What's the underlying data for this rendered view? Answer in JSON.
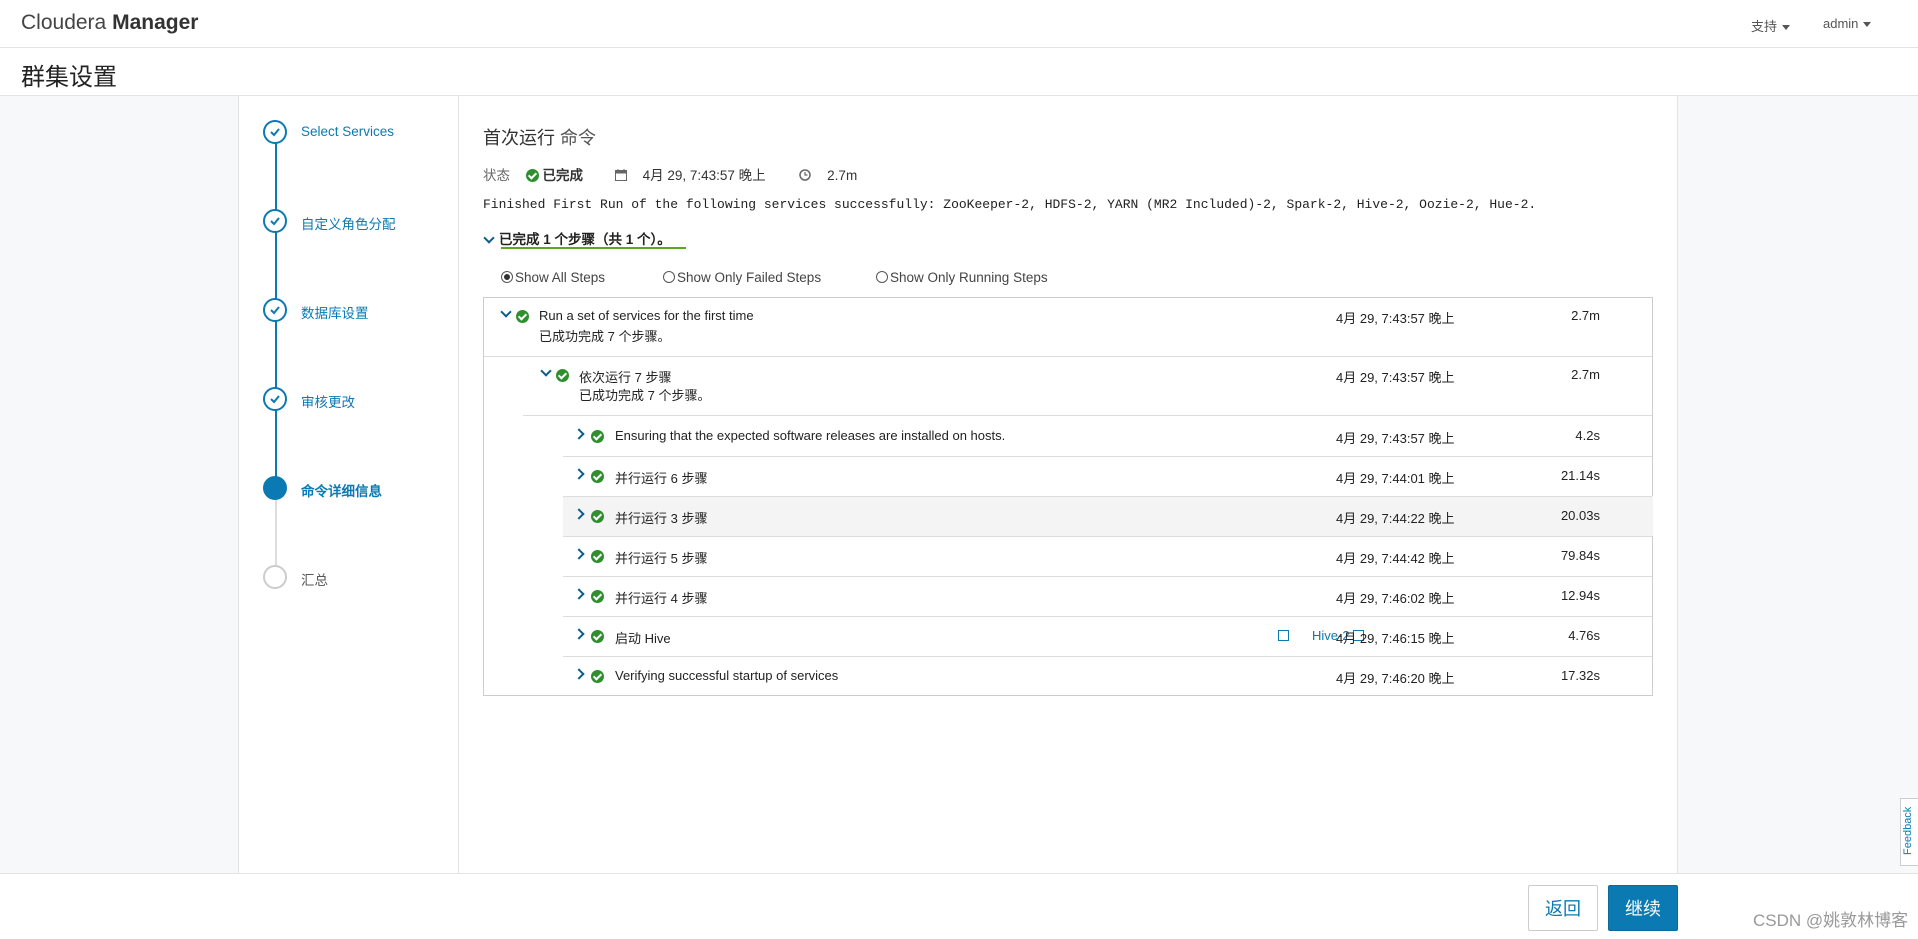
{
  "header": {
    "brand_light": "Cloudera",
    "brand_bold": "Manager",
    "support_label": "支持",
    "user_label": "admin"
  },
  "page_title": "群集设置",
  "wizard": {
    "steps": [
      {
        "label": "Select Services",
        "state": "done"
      },
      {
        "label": "自定义角色分配",
        "state": "done"
      },
      {
        "label": "数据库设置",
        "state": "done"
      },
      {
        "label": "审核更改",
        "state": "done"
      },
      {
        "label": "命令详细信息",
        "state": "active"
      },
      {
        "label": "汇总",
        "state": "pending"
      }
    ]
  },
  "command": {
    "title": "首次运行",
    "title_sub": "命令",
    "status_label": "状态",
    "status_value": "已完成",
    "date": "4月 29, 7:43:57 晚上",
    "duration": "2.7m",
    "message": "Finished First Run of the following services successfully: ZooKeeper-2, HDFS-2, YARN (MR2 Included)-2, Spark-2, Hive-2, Oozie-2, Hue-2.",
    "summary": "已完成 1 个步骤（共 1 个）。"
  },
  "filters": {
    "all": "Show All Steps",
    "failed": "Show Only Failed Steps",
    "running": "Show Only Running Steps",
    "selected": "all"
  },
  "steps": {
    "root": {
      "title": "Run a set of services for the first time",
      "detail": "已成功完成  7  个步骤。",
      "date": "4月 29, 7:43:57 晚上",
      "duration": "2.7m"
    },
    "seq": {
      "title": "依次运行 7 步骤",
      "detail": "已成功完成  7  个步骤。",
      "date": "4月 29, 7:43:57 晚上",
      "duration": "2.7m"
    },
    "children": [
      {
        "title": "Ensuring that the expected software releases are installed on hosts.",
        "date": "4月 29, 7:43:57 晚上",
        "duration": "4.2s"
      },
      {
        "title": "并行运行 6 步骤",
        "date": "4月 29, 7:44:01 晚上",
        "duration": "21.14s"
      },
      {
        "title": "并行运行 3 步骤",
        "date": "4月 29, 7:44:22 晚上",
        "duration": "20.03s"
      },
      {
        "title": "并行运行 5 步骤",
        "date": "4月 29, 7:44:42 晚上",
        "duration": "79.84s"
      },
      {
        "title": "并行运行 4 步骤",
        "date": "4月 29, 7:46:02 晚上",
        "duration": "12.94s"
      },
      {
        "title": "启动 Hive",
        "link": "Hive-2",
        "date": "4月 29, 7:46:15 晚上",
        "duration": "4.76s"
      },
      {
        "title": "Verifying successful startup of services",
        "date": "4月 29, 7:46:20 晚上",
        "duration": "17.32s"
      }
    ]
  },
  "footer": {
    "back": "返回",
    "next": "继续",
    "watermark": "CSDN @姚敦林博客",
    "feedback": "Feedback"
  },
  "colors": {
    "accent": "#0b7ab2",
    "success": "#2f8f2f",
    "underline": "#5ca71e"
  }
}
